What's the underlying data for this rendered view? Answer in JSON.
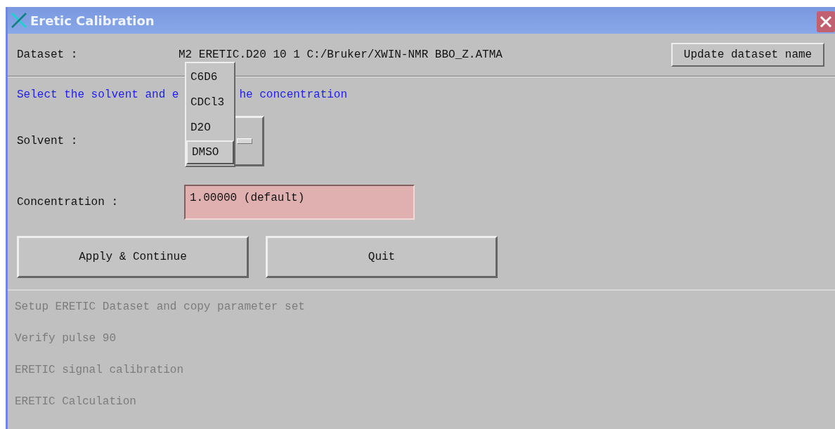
{
  "window": {
    "title": "Eretic Calibration"
  },
  "dataset": {
    "label": "Dataset :",
    "value": "M2 ERETIC.D20 10 1 C:/Bruker/XWIN-NMR BBO_Z.ATMA",
    "button": "Update dataset name"
  },
  "instruction": {
    "before_menu": "Select the solvent and e",
    "after_menu": "he concentration"
  },
  "solvent": {
    "label": "Solvent :",
    "menu": [
      {
        "label": "C6D6",
        "selected": false
      },
      {
        "label": "CDCl3",
        "selected": false
      },
      {
        "label": "D2O",
        "selected": false
      },
      {
        "label": "DMSO",
        "selected": true
      }
    ]
  },
  "concentration": {
    "label": "Concentration :",
    "value": "1.00000 (default)"
  },
  "buttons": [
    "Apply & Continue",
    "Quit"
  ],
  "steps": [
    {
      "label": "Setup ERETIC Dataset and copy parameter set",
      "disabled": true
    },
    {
      "label": "Verify pulse 90",
      "disabled": true
    },
    {
      "label": "ERETIC signal calibration",
      "disabled": true
    },
    {
      "label": "ERETIC Calculation",
      "disabled": true
    }
  ]
}
